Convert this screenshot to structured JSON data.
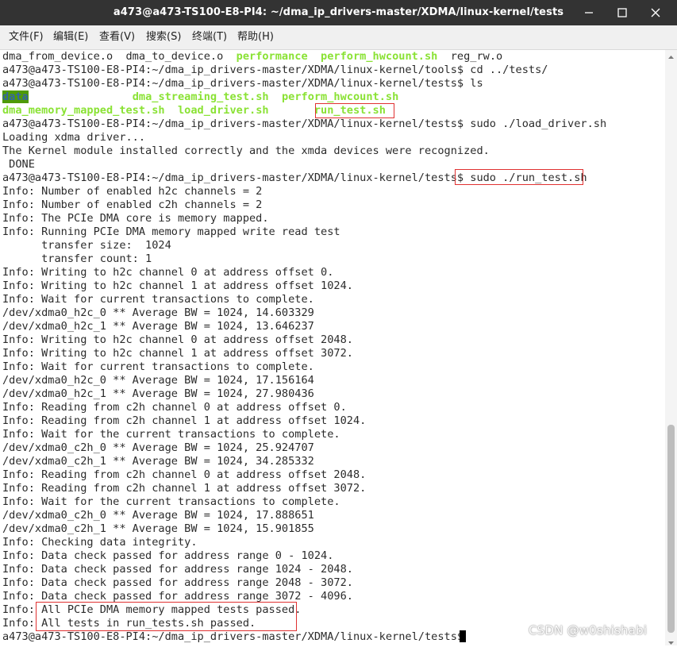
{
  "window": {
    "title": "a473@a473-TS100-E8-PI4: ~/dma_ip_drivers-master/XDMA/linux-kernel/tests"
  },
  "menu": [
    "文件(F)",
    "编辑(E)",
    "查看(V)",
    "搜索(S)",
    "终端(T)",
    "帮助(H)"
  ],
  "terminal": {
    "lines": [
      "dma_from_device.o  dma_to_device.o  ",
      "a473@a473-TS100-E8-PI4:~/dma_ip_drivers-master/XDMA/linux-kernel/tools$ cd ../tests/",
      "a473@a473-TS100-E8-PI4:~/dma_ip_drivers-master/XDMA/linux-kernel/tests$ ls",
      "",
      "",
      "a473@a473-TS100-E8-PI4:~/dma_ip_drivers-master/XDMA/linux-kernel/tests$ sudo ./load_driver.sh",
      "Loading xdma driver...",
      "The Kernel module installed correctly and the xmda devices were recognized.",
      " DONE",
      "a473@a473-TS100-E8-PI4:~/dma_ip_drivers-master/XDMA/linux-kernel/tests$ sudo ./run_test.sh",
      "Info: Number of enabled h2c channels = 2",
      "Info: Number of enabled c2h channels = 2",
      "Info: The PCIe DMA core is memory mapped.",
      "Info: Running PCIe DMA memory mapped write read test",
      "      transfer size:  1024",
      "      transfer count: 1",
      "Info: Writing to h2c channel 0 at address offset 0.",
      "Info: Writing to h2c channel 1 at address offset 1024.",
      "Info: Wait for current transactions to complete.",
      "/dev/xdma0_h2c_0 ** Average BW = 1024, 14.603329",
      "/dev/xdma0_h2c_1 ** Average BW = 1024, 13.646237",
      "Info: Writing to h2c channel 0 at address offset 2048.",
      "Info: Writing to h2c channel 1 at address offset 3072.",
      "Info: Wait for current transactions to complete.",
      "/dev/xdma0_h2c_0 ** Average BW = 1024, 17.156164",
      "/dev/xdma0_h2c_1 ** Average BW = 1024, 27.980436",
      "Info: Reading from c2h channel 0 at address offset 0.",
      "Info: Reading from c2h channel 1 at address offset 1024.",
      "Info: Wait for the current transactions to complete.",
      "/dev/xdma0_c2h_0 ** Average BW = 1024, 25.924707",
      "/dev/xdma0_c2h_1 ** Average BW = 1024, 34.285332",
      "Info: Reading from c2h channel 0 at address offset 2048.",
      "Info: Reading from c2h channel 1 at address offset 3072.",
      "Info: Wait for the current transactions to complete.",
      "/dev/xdma0_c2h_0 ** Average BW = 1024, 17.888651",
      "/dev/xdma0_c2h_1 ** Average BW = 1024, 15.901855",
      "Info: Checking data integrity.",
      "Info: Data check passed for address range 0 - 1024.",
      "Info: Data check passed for address range 1024 - 2048.",
      "Info: Data check passed for address range 2048 - 3072.",
      "Info: Data check passed for address range 3072 - 4096.",
      "Info: All PCIe DMA memory mapped tests passed.",
      "Info: All tests in run_tests.sh passed.",
      "a473@a473-TS100-E8-PI4:~/dma_ip_drivers-master/XDMA/linux-kernel/tests$ "
    ],
    "line0_exec": [
      "performance",
      "perform_hwcount.sh"
    ],
    "line0_tail": "  reg_rw.o",
    "ls_row1": {
      "dir": "data",
      "files": [
        "dma_streaming_test.sh",
        "perform_hwcount.sh"
      ]
    },
    "ls_row2": {
      "files": [
        "dma_memory_mapped_test.sh",
        "load_driver.sh",
        "run_test.sh"
      ]
    }
  },
  "watermark": "CSDN @w0shishabi",
  "colors": {
    "titlebar": "#333333",
    "executable": "#8ae234",
    "directory_bg": "#4e9a06",
    "highlight_box": "#e03131"
  }
}
